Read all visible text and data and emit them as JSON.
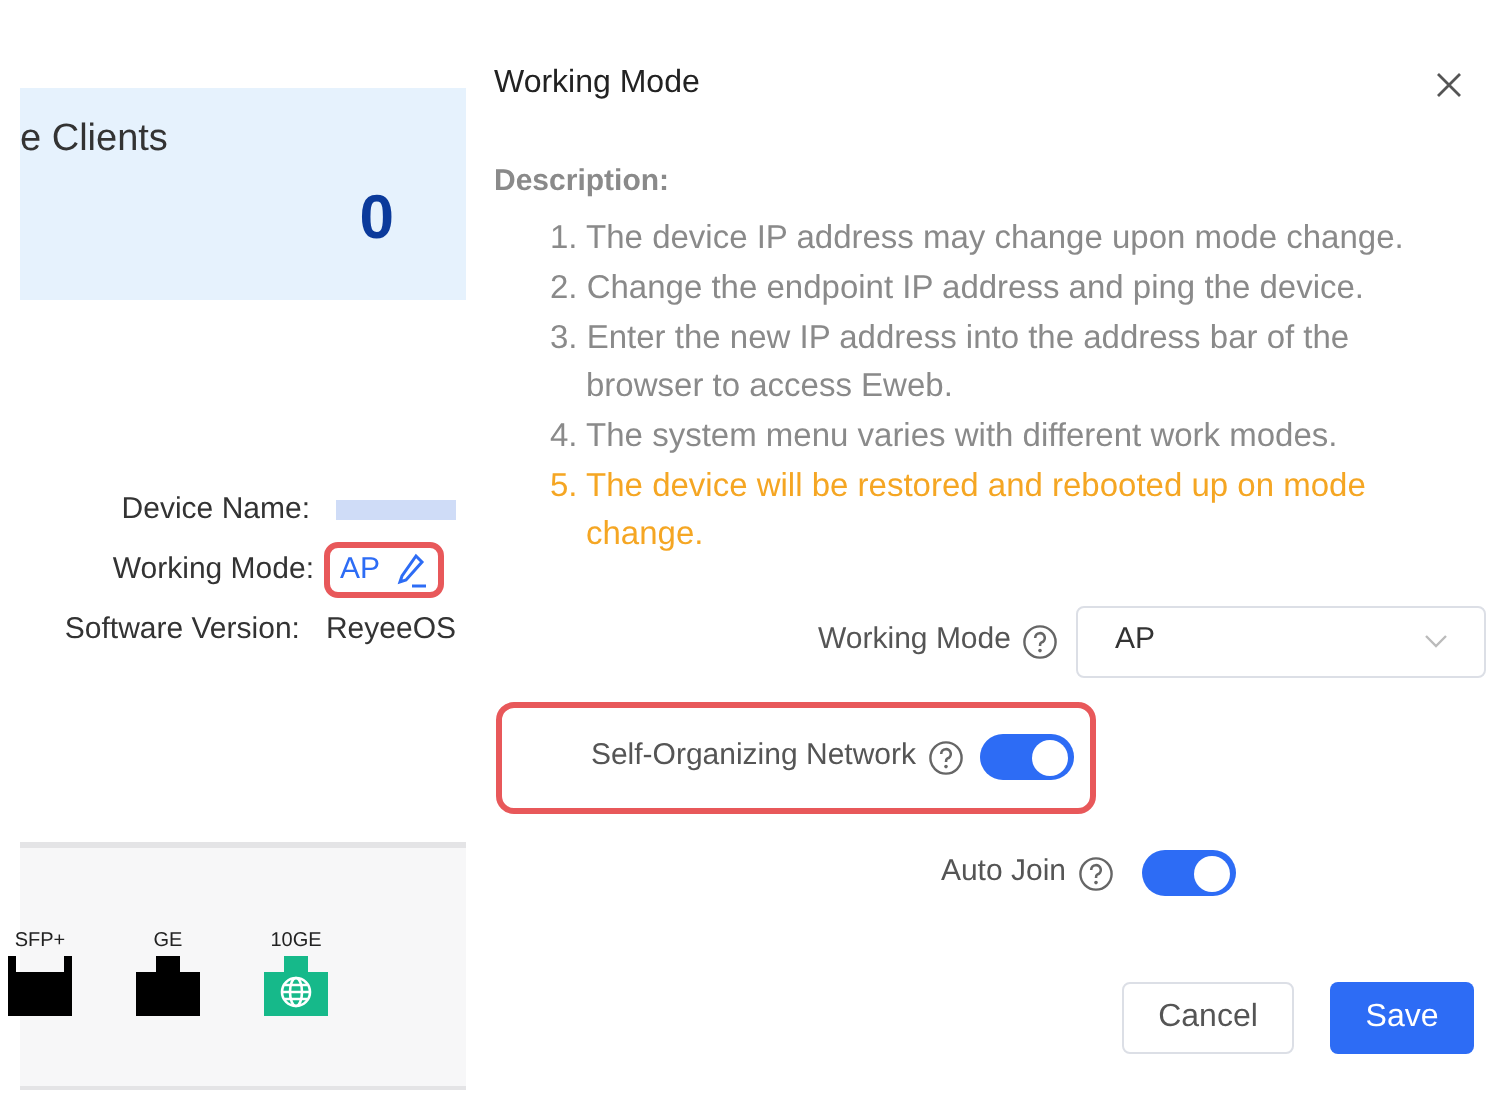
{
  "background": {
    "clients_card": {
      "label": "e Clients",
      "value": "0"
    },
    "device_info": [
      {
        "label": "Device Name:",
        "kind": "redacted",
        "highlighted": false
      },
      {
        "label": "Working Mode:",
        "value": "AP",
        "kind": "link",
        "highlighted": true
      },
      {
        "label": "Software Version:",
        "value": "ReyeeOS",
        "kind": "text",
        "highlighted": false
      }
    ],
    "ports": [
      {
        "label": "SFP+",
        "kind": "sfp",
        "connected": false
      },
      {
        "label": "GE",
        "kind": "ethernet",
        "connected": false
      },
      {
        "label": "10GE",
        "kind": "ethernet",
        "connected": true
      }
    ]
  },
  "dialog": {
    "title": "Working Mode",
    "description_title": "Description:",
    "description": [
      {
        "text": "1. The device IP address may change upon mode change.",
        "warning": false
      },
      {
        "text": "2. Change the endpoint IP address and ping the device.",
        "warning": false
      },
      {
        "text": "3. Enter the new IP address into the address bar of the browser to access Eweb.",
        "warning": false
      },
      {
        "text": "4. The system menu varies with different work modes.",
        "warning": false
      },
      {
        "text": "5. The device will be restored and rebooted up on mode change.",
        "warning": true
      }
    ],
    "fields": [
      {
        "label": "Working Mode",
        "kind": "select",
        "value": "AP",
        "highlighted": false
      },
      {
        "label": "Self-Organizing Network",
        "kind": "toggle",
        "on": true,
        "highlighted": true
      },
      {
        "label": "Auto Join",
        "kind": "toggle",
        "on": true,
        "highlighted": false
      }
    ],
    "buttons": [
      {
        "label": "Cancel",
        "kind": "secondary"
      },
      {
        "label": "Save",
        "kind": "primary"
      }
    ]
  }
}
